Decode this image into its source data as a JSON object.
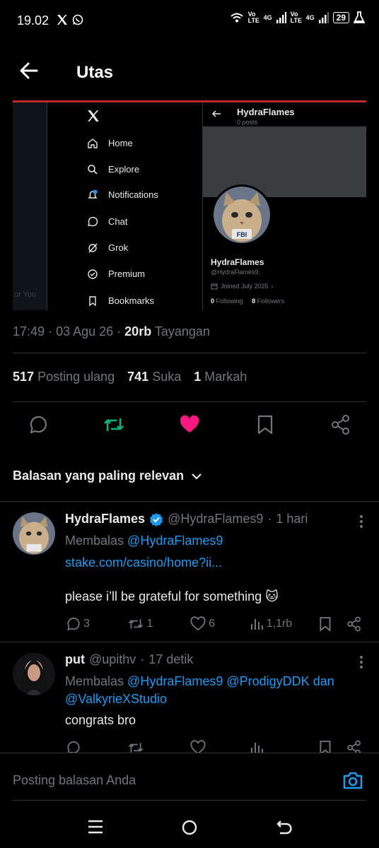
{
  "status_bar": {
    "time": "19.02",
    "net1": "Vo LTE",
    "net2": "4G",
    "net3": "Vo LTE",
    "net4": "4G",
    "battery": "29"
  },
  "header": {
    "title": "Utas"
  },
  "embedded": {
    "foryou": "or You",
    "menu": [
      "Home",
      "Explore",
      "Notifications",
      "Chat",
      "Grok",
      "Premium",
      "Bookmarks"
    ],
    "profile_name": "HydraFlames",
    "profile_posts": "0 posts",
    "display_name": "HydraFlames",
    "handle": "@HydraFlames9",
    "joined": "Joined July 2025",
    "following_count": "0",
    "following_label": "Following",
    "followers_count": "8",
    "followers_label": "Followers",
    "badge_text": "FBI"
  },
  "post_meta": {
    "time": "17:49",
    "date": "03 Agu 26",
    "views": "20rb",
    "views_label": "Tayangan"
  },
  "stats": {
    "reposts": "517",
    "reposts_label": "Posting ulang",
    "likes": "741",
    "likes_label": "Suka",
    "bookmarks": "1",
    "bookmarks_label": "Markah"
  },
  "sort_label": "Balasan yang paling relevan",
  "replies": [
    {
      "name": "HydraFlames",
      "handle": "@HydraFlames9",
      "time": "1 hari",
      "replying_prefix": "Membalas",
      "replying_to": "@HydraFlames9",
      "link": "stake.com/casino/home?ii...",
      "text": "please i’ll be grateful for something 🐱",
      "comments": "3",
      "reposts": "1",
      "likes": "6",
      "views": "1,1rb"
    },
    {
      "name": "put",
      "handle": "@upithv",
      "time": "17 detik",
      "replying_prefix": "Membalas",
      "replying_to_1": "@HydraFlames9",
      "replying_to_2": "@ProdigyDDK",
      "replying_and": "dan",
      "replying_to_3": "@ValkyrieXStudio",
      "text": "congrats bro"
    }
  ],
  "compose": {
    "placeholder": "Posting balasan Anda"
  },
  "colors": {
    "accent": "#1d9bf0",
    "repost": "#00ba7c",
    "like": "#f91880",
    "banner_red": "#c0272d"
  }
}
